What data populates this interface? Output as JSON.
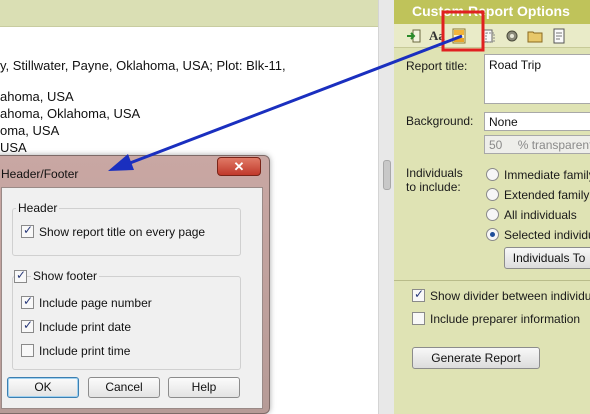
{
  "report": {
    "lines": [
      "y, Stillwater, Payne, Oklahoma, USA; Plot: Blk-11,",
      "ahoma, USA",
      "ahoma, Oklahoma, USA",
      "oma, USA",
      "USA"
    ]
  },
  "options_panel": {
    "title": "Custom Report Options",
    "toolbar": {
      "font_icon_label": "Aa",
      "icons": [
        "import-icon",
        "font-icon",
        "header-footer-icon",
        "page-layout-icon",
        "settings-icon",
        "folder-icon",
        "preview-icon"
      ]
    },
    "report_title_label": "Report title:",
    "report_title_value": "Road Trip",
    "background_label": "Background:",
    "background_value": "None",
    "transparency_value": "50",
    "transparency_suffix": "% transparent",
    "individuals_label": "Individuals to include:",
    "radio_options": [
      {
        "label": "Immediate family",
        "checked": false
      },
      {
        "label": "Extended family",
        "checked": false
      },
      {
        "label": "All individuals",
        "checked": false
      },
      {
        "label": "Selected individuals",
        "checked": true
      }
    ],
    "individuals_to_button": "Individuals To",
    "show_divider_label": "Show divider between individuals",
    "show_divider_checked": true,
    "include_preparer_label": "Include preparer information",
    "include_preparer_checked": false,
    "generate_button": "Generate Report"
  },
  "dialog": {
    "title": "Header/Footer",
    "close_label": "✕",
    "header_group_label": "Header",
    "show_report_title_label": "Show report title on every page",
    "show_report_title_checked": true,
    "show_footer_label": "Show footer",
    "show_footer_checked": true,
    "include_page_number_label": "Include page number",
    "include_page_number_checked": true,
    "include_print_date_label": "Include print date",
    "include_print_date_checked": true,
    "include_print_time_label": "Include print time",
    "include_print_time_checked": false,
    "ok_button": "OK",
    "cancel_button": "Cancel",
    "help_button": "Help"
  },
  "colors": {
    "panel_bg": "#dfe3b4",
    "panel_header": "#bfc35a",
    "highlight_box": "#e02020",
    "arrow": "#1a2fbf",
    "dialog_frame": "#c9a7a3",
    "close_button": "#c0392b"
  }
}
